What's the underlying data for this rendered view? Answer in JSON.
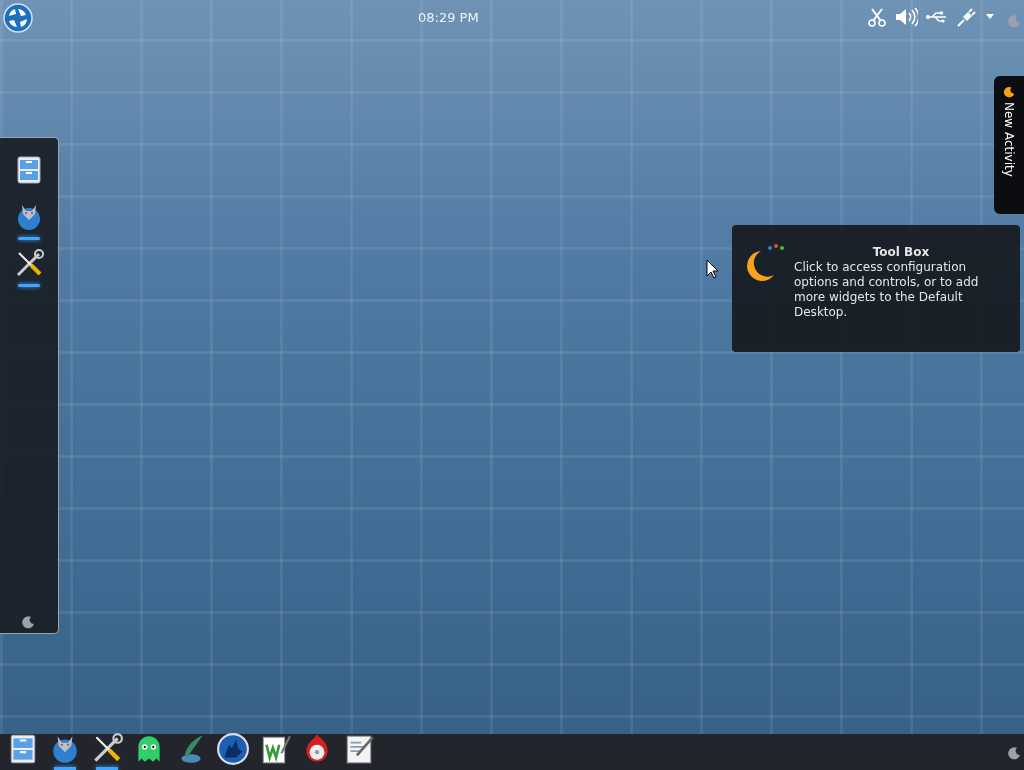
{
  "top_panel": {
    "clock": "08:29 PM"
  },
  "dock": {
    "items": [
      {
        "kind": "cabinet",
        "running": false
      },
      {
        "kind": "dragon",
        "running": true
      },
      {
        "kind": "tools",
        "running": true
      }
    ]
  },
  "tooltip": {
    "title": "Tool Box",
    "text": "Click to access configuration options and controls, or to add more widgets to the Default Desktop."
  },
  "activity_tab": {
    "label": "New Activity"
  },
  "taskbar": {
    "items": [
      {
        "kind": "cabinet",
        "running": false
      },
      {
        "kind": "dragon",
        "running": true
      },
      {
        "kind": "tools",
        "running": true
      },
      {
        "kind": "ghost",
        "running": false
      },
      {
        "kind": "quill",
        "running": false
      },
      {
        "kind": "wolf",
        "running": false
      },
      {
        "kind": "wdoc",
        "running": false
      },
      {
        "kind": "disc",
        "running": false
      },
      {
        "kind": "notepad",
        "running": false
      }
    ]
  }
}
